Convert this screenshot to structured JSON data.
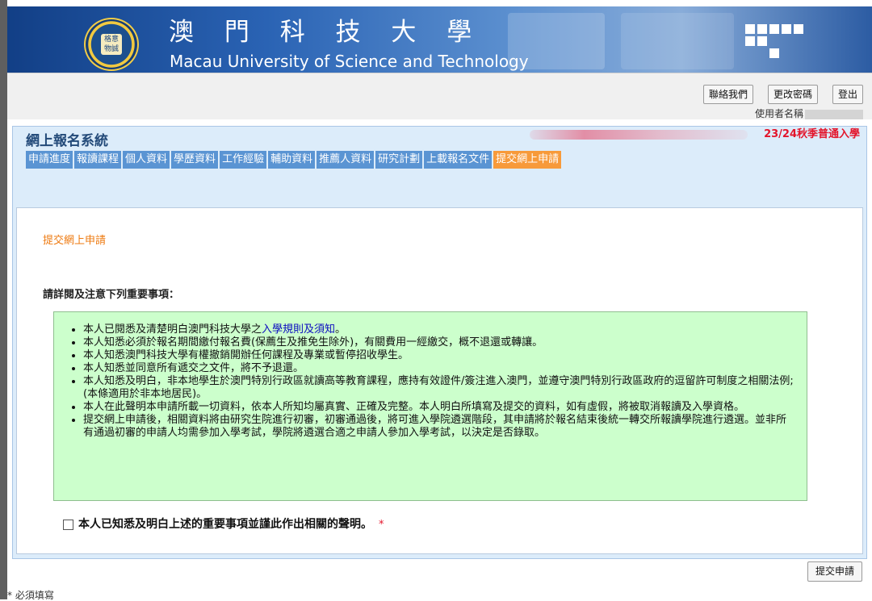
{
  "banner": {
    "name_cn": "澳 門 科 技 大 學",
    "name_en": "Macau University of Science and Technology",
    "logo_text": "格意 物誠"
  },
  "topbar": {
    "contact_label": "聯絡我們",
    "change_password_label": "更改密碼",
    "logout_label": "登出",
    "username_label": "使用者名稱"
  },
  "panel": {
    "system_title": "網上報名系統",
    "intake_label": "23/24秋季普通入學",
    "tabs": [
      {
        "label": "申請進度"
      },
      {
        "label": "報讀課程"
      },
      {
        "label": "個人資料"
      },
      {
        "label": "學歷資料"
      },
      {
        "label": "工作經驗"
      },
      {
        "label": "輔助資料"
      },
      {
        "label": "推薦人資料"
      },
      {
        "label": "研究計劃"
      },
      {
        "label": "上載報名文件"
      },
      {
        "label": "提交網上申請"
      }
    ]
  },
  "content": {
    "section_title": "提交網上申請",
    "notice_heading": "請詳閱及注意下列重要事項：",
    "notices": {
      "n1_prefix": "本人已閱悉及清楚明白澳門科技大學之",
      "n1_link": "入學規則及須知",
      "n1_suffix": "。",
      "n2": "本人知悉必須於報名期間繳付報名費(保薦生及推免生除外)，有關費用一經繳交，概不退還或轉讓。",
      "n3": "本人知悉澳門科技大學有權撤銷開辦任何課程及專業或暫停招收學生。",
      "n4": "本人知悉並同意所有遞交之文件，將不予退還。",
      "n5": "本人知悉及明白，非本地學生於澳門特別行政區就讀高等教育課程，應持有效證件/簽注進入澳門，並遵守澳門特別行政區政府的逗留許可制度之相關法例; (本條適用於非本地居民)。",
      "n6": "本人在此聲明本申請所載一切資料，依本人所知均屬真實、正確及完整。本人明白所填寫及提交的資料，如有虛假，將被取消報讀及入學資格。",
      "n7": "提交網上申請後，相關資料將由研究生院進行初審，初審通過後，將可進入學院遴選階段，其申請將於報名結束後統一轉交所報讀學院進行遴選。並非所有通過初審的申請人均需參加入學考試，學院將遴選合適之申請人參加入學考試，以決定是否錄取。"
    },
    "agree_text": "本人已知悉及明白上述的重要事項並謹此作出相關的聲明。",
    "required_star": "*"
  },
  "actions": {
    "submit_label": "提交申請"
  },
  "footnote": "* 必須填寫",
  "colors": {
    "tab_bg": "#5a94d3",
    "tab_active_bg": "#f79a3a",
    "panel_bg": "#dcecfa",
    "notice_bg": "#ccffcc",
    "section_title": "#ee7a10",
    "intake_label": "#e3152b"
  }
}
